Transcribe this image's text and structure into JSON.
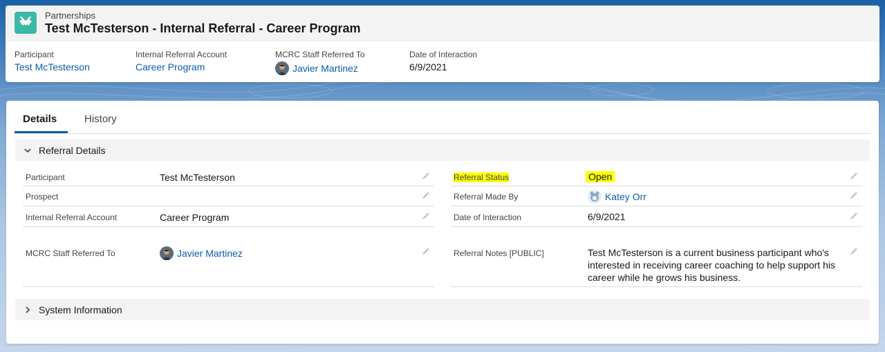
{
  "colors": {
    "brand_blue": "#0b5cab",
    "object_icon": "#3cb8a8",
    "highlight": "#ffff00"
  },
  "header": {
    "object_type": "Partnerships",
    "record_title": "Test McTesterson - Internal Referral - Career Program",
    "icon": "handshake-icon"
  },
  "highlights": [
    {
      "label": "Participant",
      "value": "Test McTesterson"
    },
    {
      "label": "Internal Referral Account",
      "value": "Career Program"
    },
    {
      "label": "MCRC Staff Referred To",
      "value": "Javier Martinez"
    },
    {
      "label": "Date of Interaction",
      "value": "6/9/2021"
    }
  ],
  "tabs": [
    {
      "label": "Details",
      "active": true
    },
    {
      "label": "History",
      "active": false
    }
  ],
  "sections": {
    "referral_details": {
      "title": "Referral Details",
      "left_fields": [
        {
          "label": "Participant",
          "value": "Test McTesterson"
        },
        {
          "label": "Prospect",
          "value": ""
        },
        {
          "label": "Internal Referral Account",
          "value": "Career Program"
        },
        {
          "label": "MCRC Staff Referred To",
          "value": "Javier Martinez"
        }
      ],
      "right_fields": [
        {
          "label": "Referral Status",
          "value": "Open"
        },
        {
          "label": "Referral Made By",
          "value": "Katey Orr"
        },
        {
          "label": "Date of Interaction",
          "value": "6/9/2021"
        },
        {
          "label": "Referral Notes [PUBLIC]",
          "value": "Test McTesterson is a current business participant who's interested in receiving career coaching to help support his career while he grows his business."
        }
      ]
    },
    "system_information": {
      "title": "System Information"
    }
  }
}
